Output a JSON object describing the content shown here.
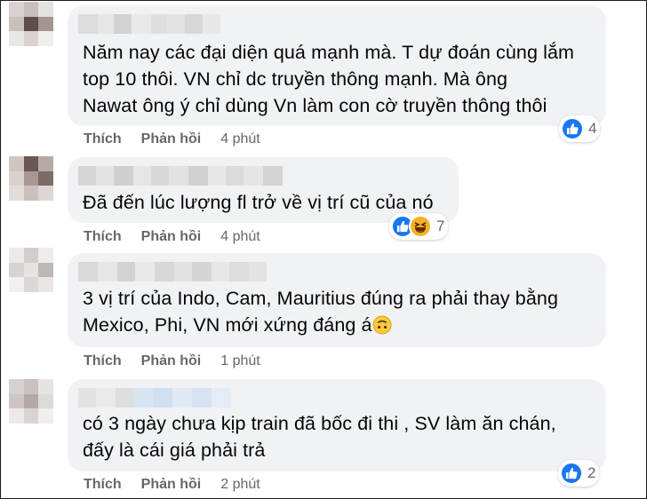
{
  "comments": [
    {
      "text": "Năm nay các đại diện quá mạnh mà. T dự đoán cùng lắm\ntop 10 thôi. VN chỉ dc truyền thông mạnh. Mà ông\nNawat ông ý chỉ dùng Vn làm con cờ truyền thông thôi",
      "like_label": "Thích",
      "reply_label": "Phản hồi",
      "time": "4 phút",
      "reaction_count": "4",
      "reactions": [
        "like"
      ]
    },
    {
      "text": "Đã đến lúc lượng fl trở về vị trí cũ của nó",
      "like_label": "Thích",
      "reply_label": "Phản hồi",
      "time": "4 phút",
      "reaction_count": "7",
      "reactions": [
        "like",
        "haha"
      ]
    },
    {
      "text": "3 vị trí của Indo, Cam, Mauritius đúng ra phải thay bằng\nMexico, Phi, VN mới xứng đáng á",
      "trailing_emoji": "upside-down-face",
      "like_label": "Thích",
      "reply_label": "Phản hồi",
      "time": "1 phút"
    },
    {
      "text": "có 3 ngày chưa kịp train đã bốc đi thi , SV làm ăn chán,\nđấy là cái giá phải trả",
      "like_label": "Thích",
      "reply_label": "Phản hồi",
      "time": "2 phút",
      "reaction_count": "2",
      "reactions": [
        "like"
      ]
    }
  ],
  "colors": {
    "bubble": "#f0f2f5",
    "meta_text": "#65676b",
    "like_blue": "#1877f2",
    "haha_yellow": "#f7b125"
  }
}
